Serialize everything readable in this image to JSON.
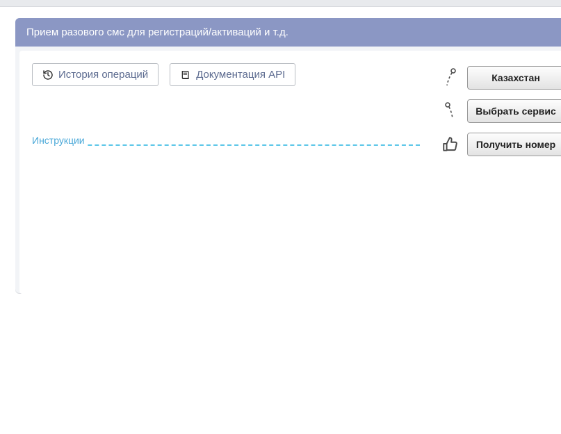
{
  "panel": {
    "title": "Прием разового смс для регистраций/активаций и т.д."
  },
  "toolbar": {
    "history_label": "История операций",
    "api_docs_label": "Документация API"
  },
  "instructions": {
    "label": "Инструкции"
  },
  "steps": {
    "country_label": "Казахстан",
    "service_label": "Выбрать сервис",
    "get_number_label": "Получить номер"
  }
}
